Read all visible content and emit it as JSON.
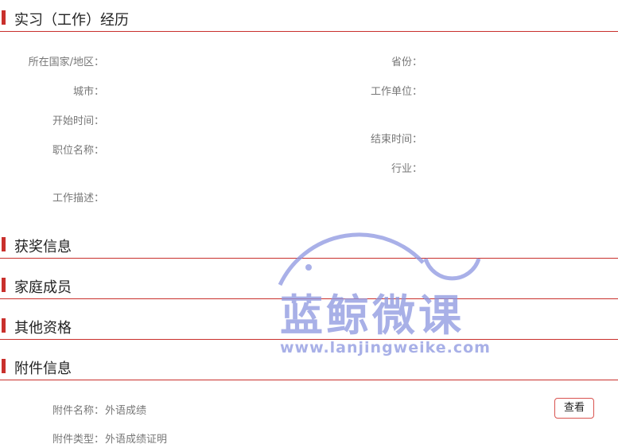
{
  "internship": {
    "title": "实习（工作）经历",
    "fields": {
      "country_label": "所在国家/地区：",
      "province_label": "省份：",
      "city_label": "城市：",
      "employer_label": "工作单位：",
      "start_label": "开始时间：",
      "end_label": "结束时间：",
      "position_label": "职位名称：",
      "industry_label": "行业：",
      "description_label": "工作描述："
    }
  },
  "awards": {
    "title": "获奖信息"
  },
  "family": {
    "title": "家庭成员"
  },
  "qualifications": {
    "title": "其他资格"
  },
  "attachments": {
    "title": "附件信息",
    "name_label": "附件名称：",
    "name_value": "外语成绩",
    "type_label": "附件类型：",
    "type_value": "外语成绩证明",
    "view_button": "查看"
  },
  "watermark": {
    "brand": "蓝鲸微课",
    "url": "www.lanjingweike.com",
    "color": "#8c96e0"
  },
  "colors": {
    "accent": "#c9302c"
  }
}
